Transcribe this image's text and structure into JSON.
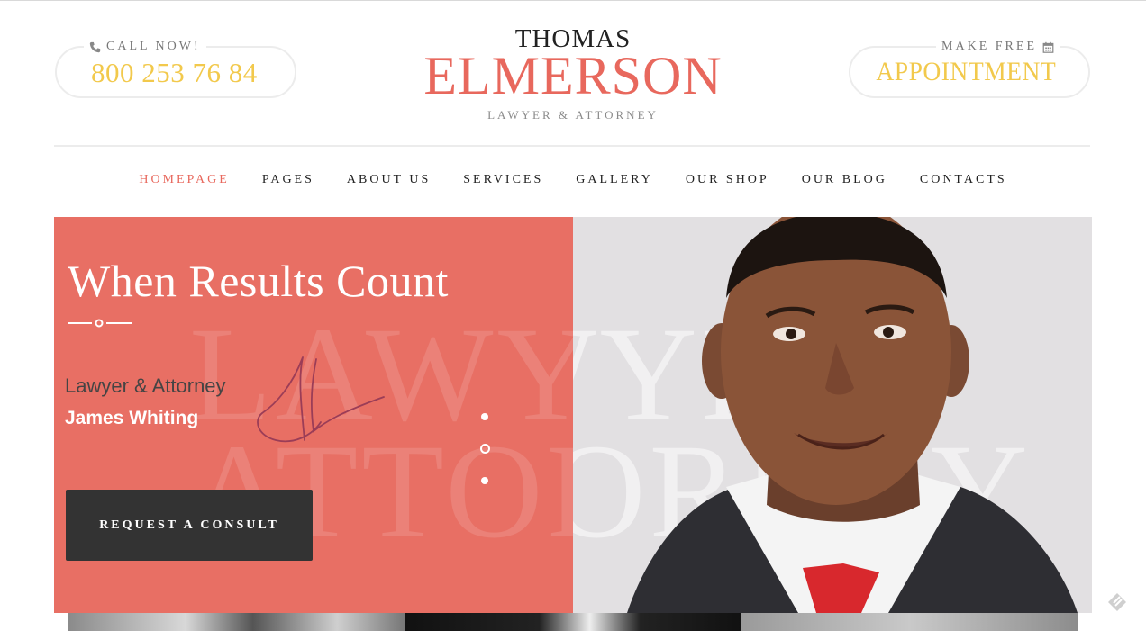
{
  "header": {
    "call": {
      "caption": "CALL NOW!",
      "icon": "phone-icon",
      "phone": "800 253 76 84"
    },
    "appointment": {
      "caption": "MAKE FREE",
      "icon": "calendar-icon",
      "label": "APPOINTMENT"
    },
    "logo": {
      "first": "THOMAS",
      "last": "ELMERSON",
      "subtitle": "LAWYER & ATTORNEY"
    }
  },
  "nav": {
    "items": [
      "HOMEPAGE",
      "PAGES",
      "ABOUT US",
      "SERVICES",
      "GALLERY",
      "OUR SHOP",
      "OUR BLOG",
      "CONTACTS"
    ],
    "active_index": 0
  },
  "hero": {
    "title": "When Results Count",
    "watermark_line1": "LAWYER",
    "watermark_line2": "ATTORNEY",
    "role": "Lawyer & Attorney",
    "name": "James Whiting",
    "cta": "REQUEST A CONSULT",
    "slider": {
      "count": 3,
      "active_index": 1
    }
  },
  "colors": {
    "accent": "#e8685d",
    "hero_bg": "#e86f64",
    "gold": "#f2c94c",
    "button": "#333333"
  }
}
